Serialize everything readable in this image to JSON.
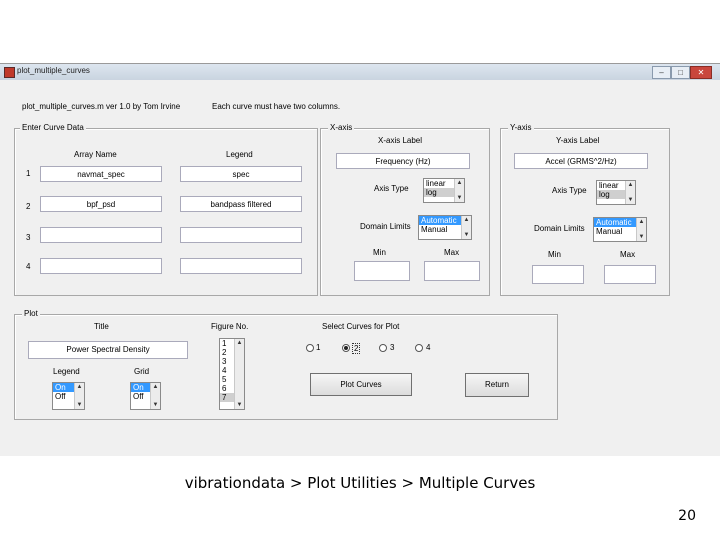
{
  "window": {
    "title": "plot_multiple_curves",
    "controls": {
      "minimize": "–",
      "maximize": "□",
      "close": "✕"
    }
  },
  "header": {
    "version_text": "plot_multiple_curves.m  ver 1.0   by Tom Irvine",
    "note": "Each curve must have two columns."
  },
  "curve_panel": {
    "label": "Enter Curve Data",
    "col_array": "Array Name",
    "col_legend": "Legend",
    "rows": [
      {
        "num": "1",
        "array": "navmat_spec",
        "legend": "spec"
      },
      {
        "num": "2",
        "array": "bpf_psd",
        "legend": "bandpass filtered"
      },
      {
        "num": "3",
        "array": "",
        "legend": ""
      },
      {
        "num": "4",
        "array": "",
        "legend": ""
      }
    ]
  },
  "xaxis_panel": {
    "label": "X-axis",
    "axis_label_title": "X-axis Label",
    "axis_label_value": "Frequency (Hz)",
    "axis_type_label": "Axis Type",
    "axis_type_options": [
      "linear",
      "log"
    ],
    "domain_label": "Domain Limits",
    "domain_options": [
      "Automatic",
      "Manual"
    ],
    "min_label": "Min",
    "max_label": "Max"
  },
  "yaxis_panel": {
    "label": "Y-axis",
    "axis_label_title": "Y-axis Label",
    "axis_label_value": "Accel (GRMS^2/Hz)",
    "axis_type_label": "Axis Type",
    "axis_type_options": [
      "linear",
      "log"
    ],
    "domain_label": "Domain Limits",
    "domain_options": [
      "Automatic",
      "Manual"
    ],
    "min_label": "Min",
    "max_label": "Max"
  },
  "plot_panel": {
    "label": "Plot",
    "title_label": "Title",
    "title_value": "Power Spectral Density",
    "legend_label": "Legend",
    "legend_options": [
      "On",
      "Off"
    ],
    "grid_label": "Grid",
    "grid_options": [
      "On",
      "Off"
    ],
    "figure_label": "Figure No.",
    "figure_options": [
      "1",
      "2",
      "3",
      "4",
      "5",
      "6",
      "7"
    ],
    "select_label": "Select Curves for Plot",
    "curve_choices": [
      "1",
      "2",
      "3",
      "4"
    ],
    "selected_curve": "2",
    "plot_button": "Plot Curves",
    "return_button": "Return"
  },
  "footer": {
    "breadcrumb": "vibrationdata > Plot Utilities > Multiple Curves",
    "page_number": "20"
  }
}
